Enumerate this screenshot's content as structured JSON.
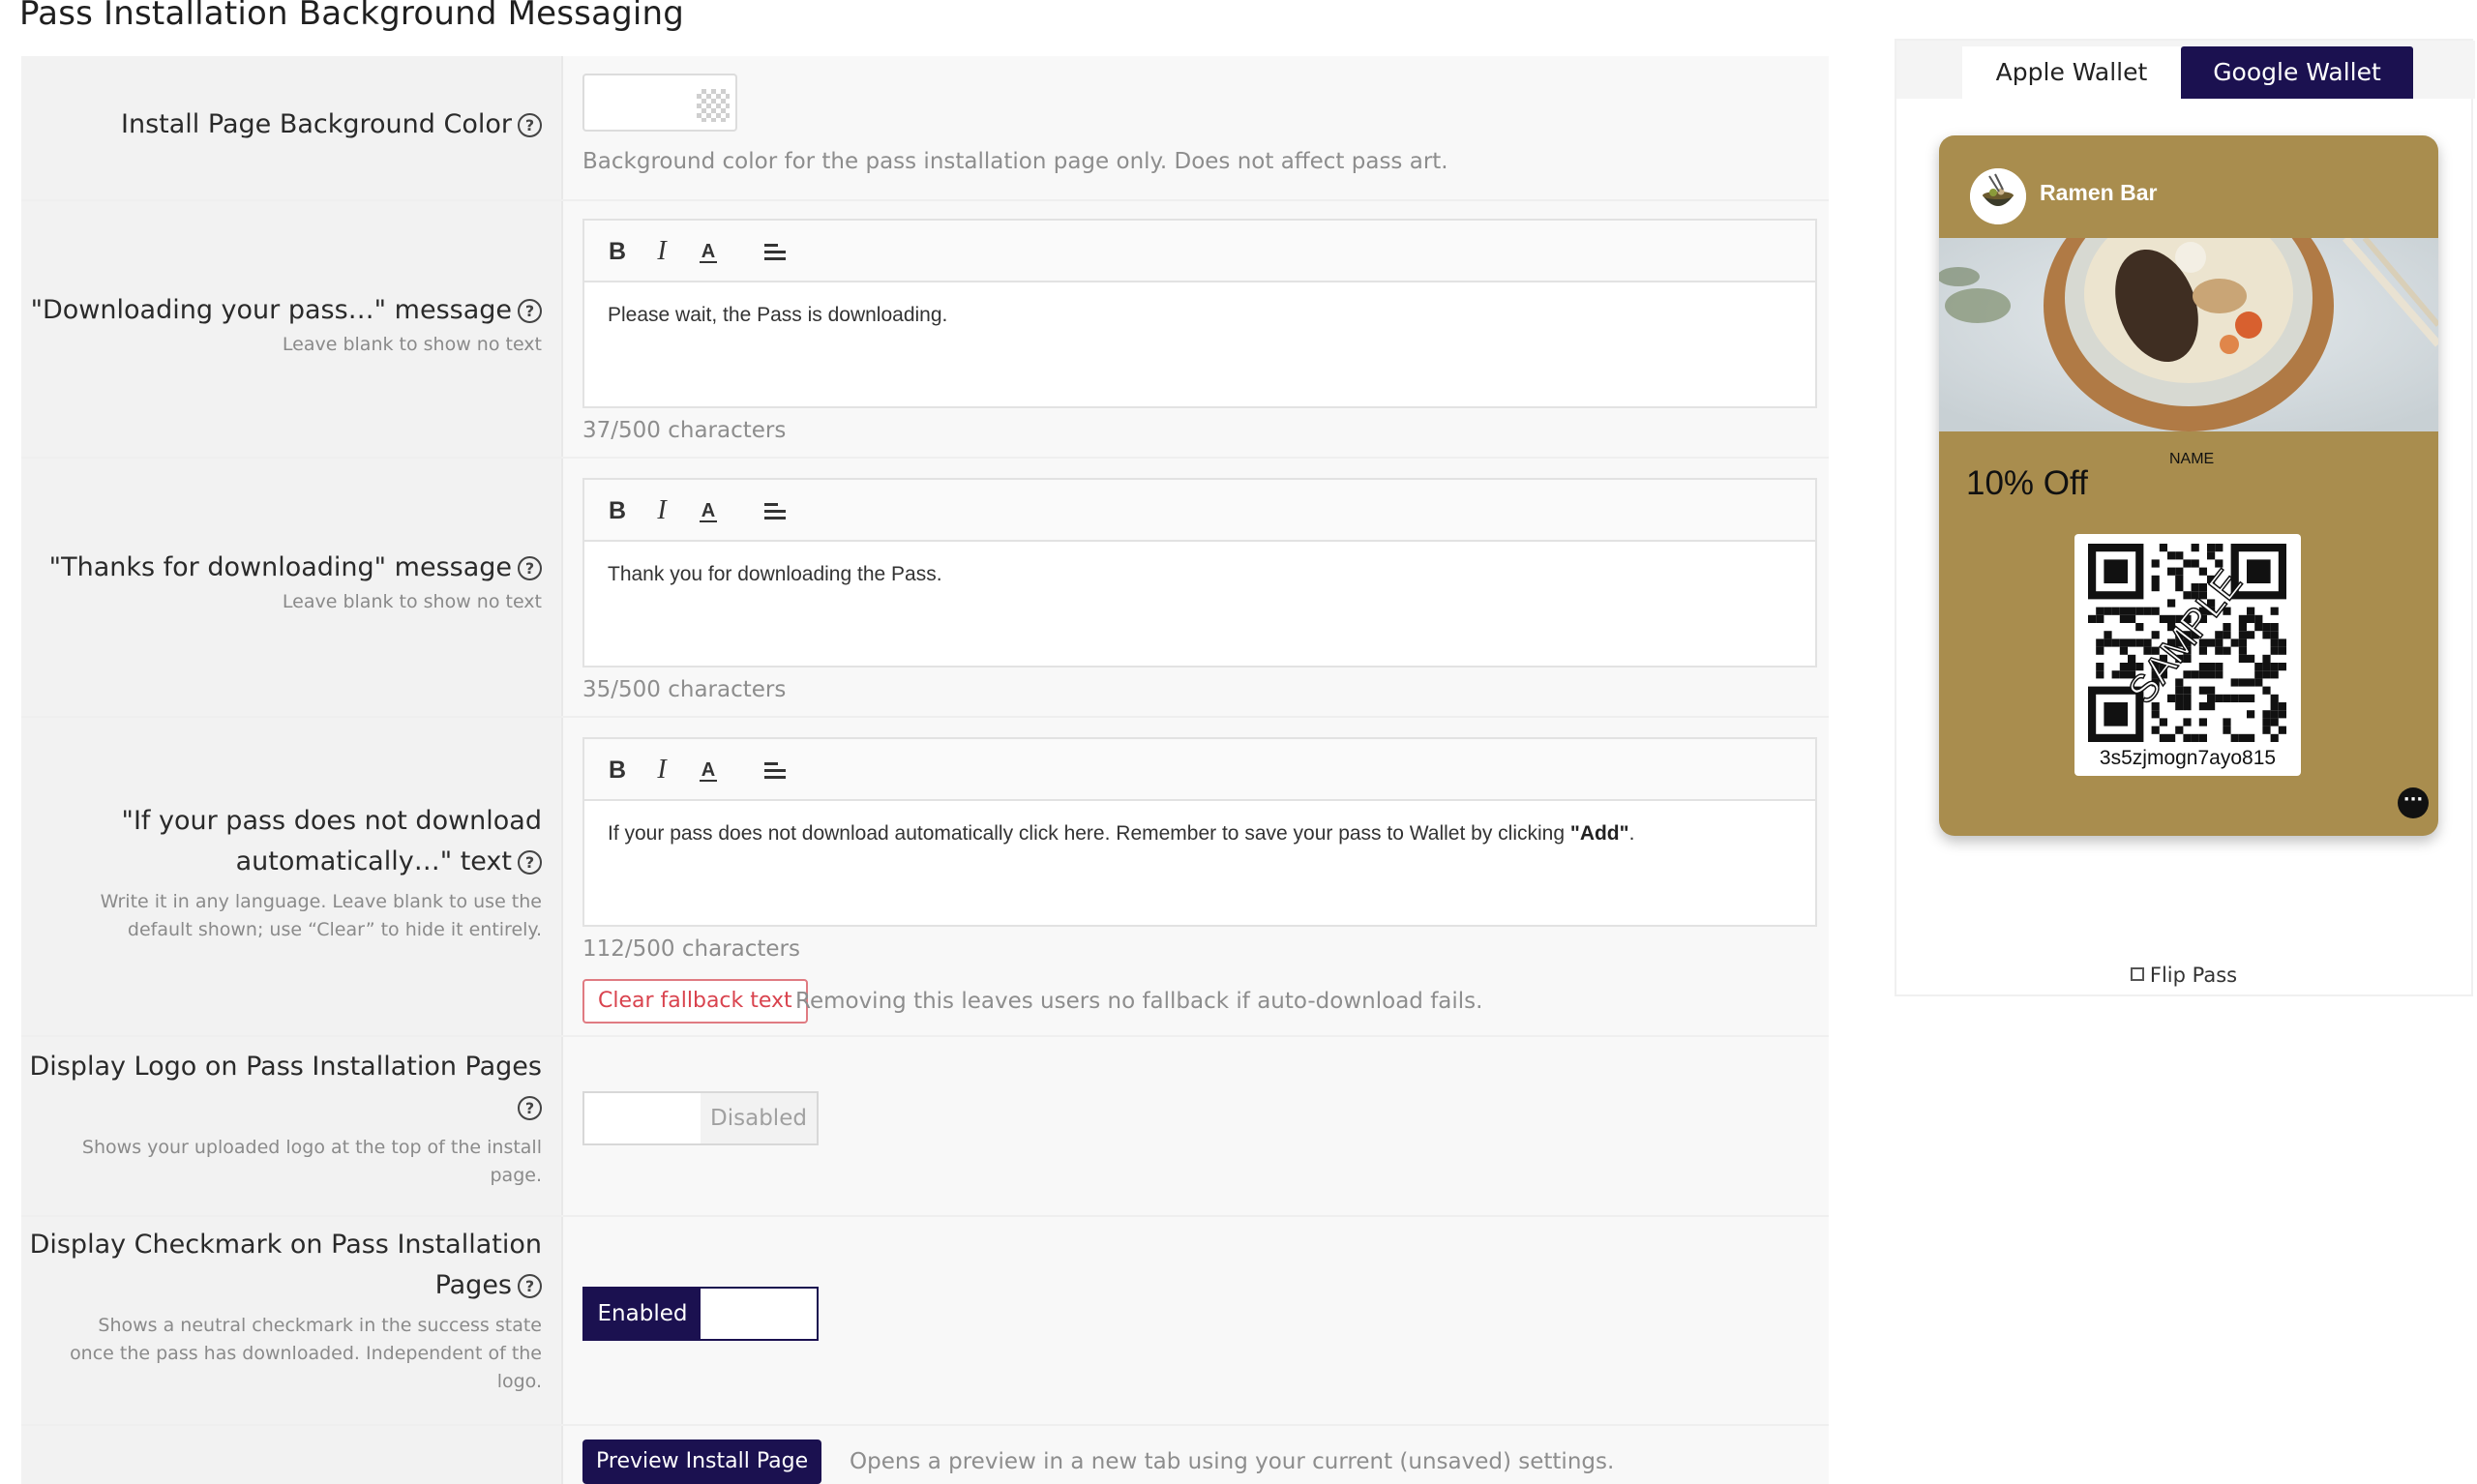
{
  "page_title": "Pass Installation Background Messaging",
  "rows": {
    "bg_color": {
      "label": "Install Page Background Color",
      "description": "Background color for the pass installation page only. Does not affect pass art."
    },
    "downloading": {
      "label": "\"Downloading your pass…\" message",
      "help": "Leave blank to show no text",
      "content": "Please wait, the Pass is downloading.",
      "counter": "37/500 characters"
    },
    "thanks": {
      "label": "\"Thanks for downloading\" message",
      "help": "Leave blank to show no text",
      "content": "Thank you for downloading the Pass.",
      "counter": "35/500 characters"
    },
    "fallback": {
      "label_line1": "\"If your pass does not download",
      "label_line2": "automatically…\" text",
      "help_line1": "Write it in any language. Leave blank to use the",
      "help_line2": "default shown; use “Clear” to hide it entirely.",
      "content_prefix": "If your pass does not download automatically click here. Remember to save your pass to Wallet by clicking ",
      "content_bold": "\"Add\"",
      "content_suffix": ".",
      "counter": "112/500 characters",
      "clear_button": "Clear fallback text",
      "clear_note": "Removing this leaves users no fallback if auto-download fails."
    },
    "logo": {
      "label": "Display Logo on Pass Installation Pages",
      "help_line1": "Shows your uploaded logo at the top of the install",
      "help_line2": "page.",
      "toggle_label": "Disabled"
    },
    "checkmark": {
      "label_line1": "Display Checkmark on Pass Installation",
      "label_line2": "Pages",
      "help_line1": "Shows a neutral checkmark in the success state",
      "help_line2": "once the pass has downloaded. Independent of the",
      "help_line3": "logo.",
      "toggle_label": "Enabled"
    },
    "preview": {
      "button": "Preview Install Page",
      "note": "Opens a preview in a new tab using your current (unsaved) settings."
    }
  },
  "editor_toolbar": {
    "bold": "B",
    "italic": "I",
    "color": "A"
  },
  "preview_panel": {
    "tabs": {
      "apple": "Apple Wallet",
      "google": "Google Wallet",
      "active": "google"
    },
    "card": {
      "merchant": "Ramen Bar",
      "field_label": "NAME",
      "offer": "10% Off",
      "barcode_value": "3s5zjmogn7ayo815",
      "watermark": "SAMPLE",
      "more": "···"
    },
    "flip_label": "Flip Pass"
  },
  "colors": {
    "accent": "#1b1150",
    "card_bg": "#a98d4e",
    "danger": "#d9434e"
  },
  "icons": [
    "help-circle-icon",
    "bold-icon",
    "italic-icon",
    "text-color-icon",
    "align-left-icon",
    "checker-transparent-icon",
    "flip-icon",
    "more-icon"
  ]
}
